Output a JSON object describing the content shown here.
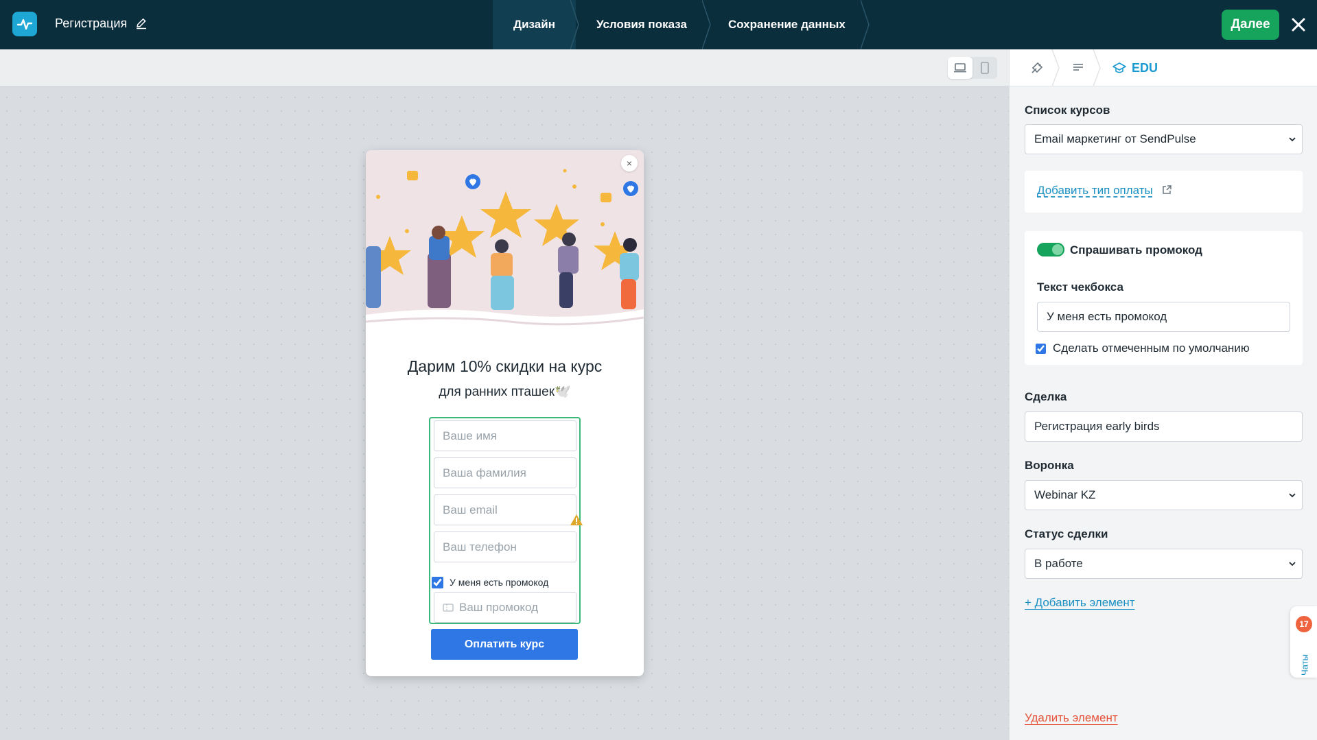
{
  "header": {
    "page_title": "Регистрация",
    "steps": [
      {
        "label": "Дизайн",
        "active": true
      },
      {
        "label": "Условия показа",
        "active": false
      },
      {
        "label": "Сохранение данных",
        "active": false
      }
    ],
    "next_label": "Далее"
  },
  "canvas": {
    "device_modes": [
      "desktop",
      "mobile"
    ],
    "selected_device": "desktop"
  },
  "popup": {
    "heading": "Дарим 10% скидки на курс",
    "subheading": "для ранних пташек🕊️",
    "fields": {
      "name_placeholder": "Ваше имя",
      "surname_placeholder": "Ваша фамилия",
      "email_placeholder": "Ваш email",
      "phone_placeholder": "Ваш телефон",
      "promo_placeholder": "Ваш промокод"
    },
    "promo_checkbox_label": "У меня есть промокод",
    "promo_checked": true,
    "pay_button": "Оплатить курс",
    "close_symbol": "×"
  },
  "panel": {
    "tabs": [
      {
        "icon": "style-icon"
      },
      {
        "icon": "form-icon"
      },
      {
        "icon": "graduation-cap-icon",
        "label": "EDU"
      }
    ],
    "courses": {
      "label": "Список курсов",
      "value": "Email маркетинг от SendPulse"
    },
    "add_payment_link": "Добавить тип оплаты",
    "ask_promo": {
      "label": "Спрашивать промокод",
      "enabled": true
    },
    "checkbox_text": {
      "label": "Текст чекбокса",
      "value": "У меня есть промокод"
    },
    "default_checked": {
      "label": "Сделать отмеченным по умолчанию",
      "checked": true
    },
    "deal": {
      "label": "Сделка",
      "value": "Регистрация early birds"
    },
    "funnel": {
      "label": "Воронка",
      "value": "Webinar KZ"
    },
    "deal_status": {
      "label": "Статус сделки",
      "value": "В работе"
    },
    "add_element": "+ Добавить элемент",
    "delete_element": "Удалить элемент"
  },
  "chats": {
    "label": "Чаты",
    "badge": "17"
  },
  "colors": {
    "header_bg": "#0b2e3d",
    "accent_green": "#16a35b",
    "primary_blue": "#2f77e5",
    "link_blue": "#1a8fc2",
    "danger": "#e5533b"
  }
}
